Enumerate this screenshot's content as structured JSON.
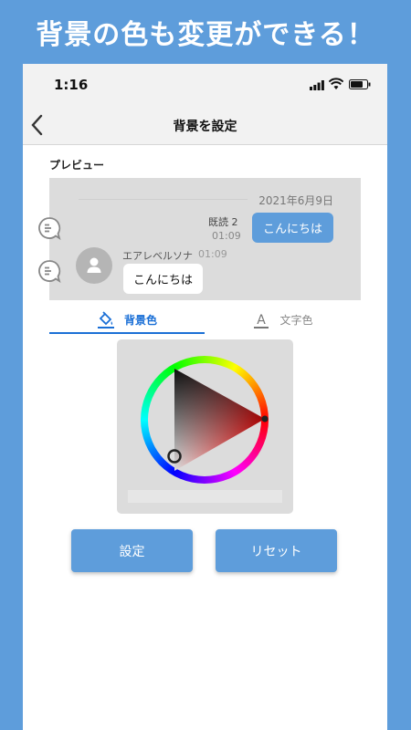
{
  "banner": {
    "title": "背景の色も変更ができる！"
  },
  "status_bar": {
    "time": "1:16"
  },
  "nav": {
    "title": "背景を設定"
  },
  "preview": {
    "label": "プレビュー",
    "date": "2021年6月9日",
    "sent": {
      "read_label": "既読 2",
      "time": "01:09",
      "text": "こんにちは"
    },
    "received": {
      "sender": "エアレベルソナ",
      "time": "01:09",
      "text": "こんにちは"
    }
  },
  "tabs": [
    {
      "label": "背景色",
      "icon": "paint-bucket-icon",
      "active": true
    },
    {
      "label": "文字色",
      "icon": "text-color-icon",
      "active": false
    }
  ],
  "picker": {
    "selected_hue": "#ff0000"
  },
  "buttons": {
    "set_label": "設定",
    "reset_label": "リセット"
  },
  "colors": {
    "accent": "#5e9ddb",
    "tab_active": "#1a6fd6",
    "preview_bg": "#dcdcdc"
  }
}
